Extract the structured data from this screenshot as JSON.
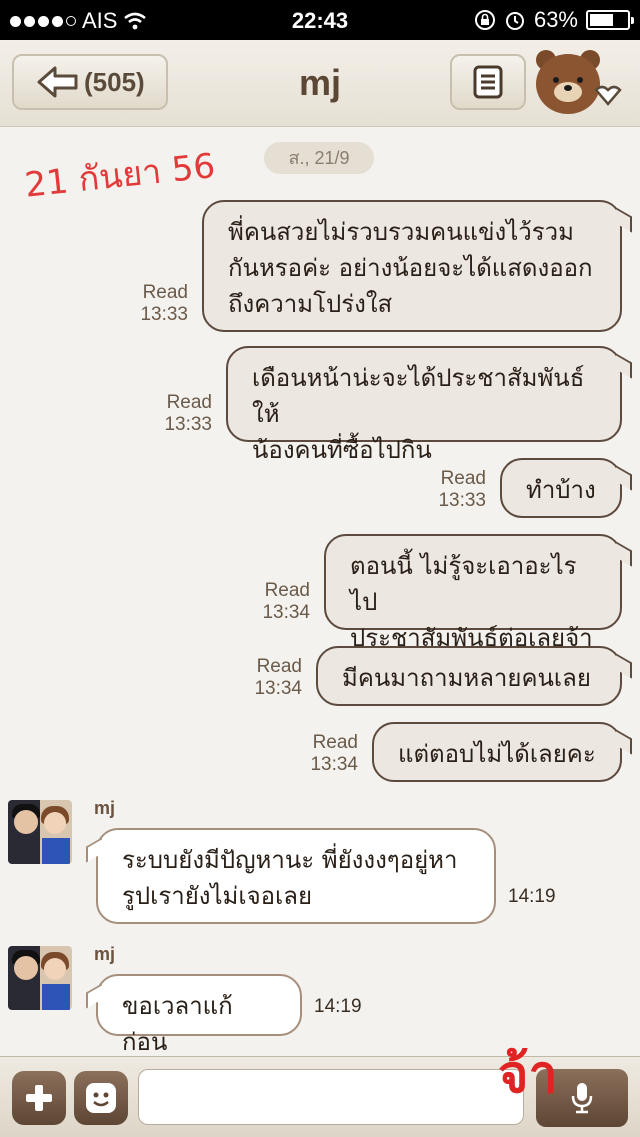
{
  "status_bar": {
    "carrier": "AIS",
    "time": "22:43",
    "battery": "63%",
    "battery_level": 0.63
  },
  "header": {
    "unread_count": "(505)",
    "title": "mj"
  },
  "chat": {
    "date": "ส., 21/9",
    "annotation": "21 กันยา 56",
    "outgoing": [
      {
        "status": "Read",
        "time": "13:33",
        "text": "พี่คนสวยไม่รวบรวมคนแข่งไว้รวม\nกันหรอค่ะ อย่างน้อยจะได้แสดงออก\nถึงความโปร่งใส"
      },
      {
        "status": "Read",
        "time": "13:33",
        "text": "เดือนหน้าน่ะจะได้ประชาสัมพันธ์ให้\nน้องคนที่ซื้อไปกิน"
      },
      {
        "status": "Read",
        "time": "13:33",
        "text": "ทำบ้าง"
      },
      {
        "status": "Read",
        "time": "13:34",
        "text": "ตอนนี้ ไม่รู้จะเอาอะไรไป\nประชาสัมพันธ์ต่อเลยจ้า"
      },
      {
        "status": "Read",
        "time": "13:34",
        "text": "มีคนมาถามหลายคนเลย"
      },
      {
        "status": "Read",
        "time": "13:34",
        "text": "แต่ตอบไม่ได้เลยคะ"
      }
    ],
    "incoming": [
      {
        "sender": "mj",
        "time": "14:19",
        "text": "ระบบยังมีปัญหานะ พี่ยังงงๆอยู่หา\nรูปเรายังไม่เจอเลย"
      },
      {
        "sender": "mj",
        "time": "14:19",
        "text": "ขอเวลาแก้ก่อน"
      }
    ]
  },
  "input_bar": {
    "overlay_text": "จ้า"
  },
  "colors": {
    "accent": "#5e4635",
    "bubble_out": "#ece7e0",
    "annotation": "#e23a3a"
  }
}
